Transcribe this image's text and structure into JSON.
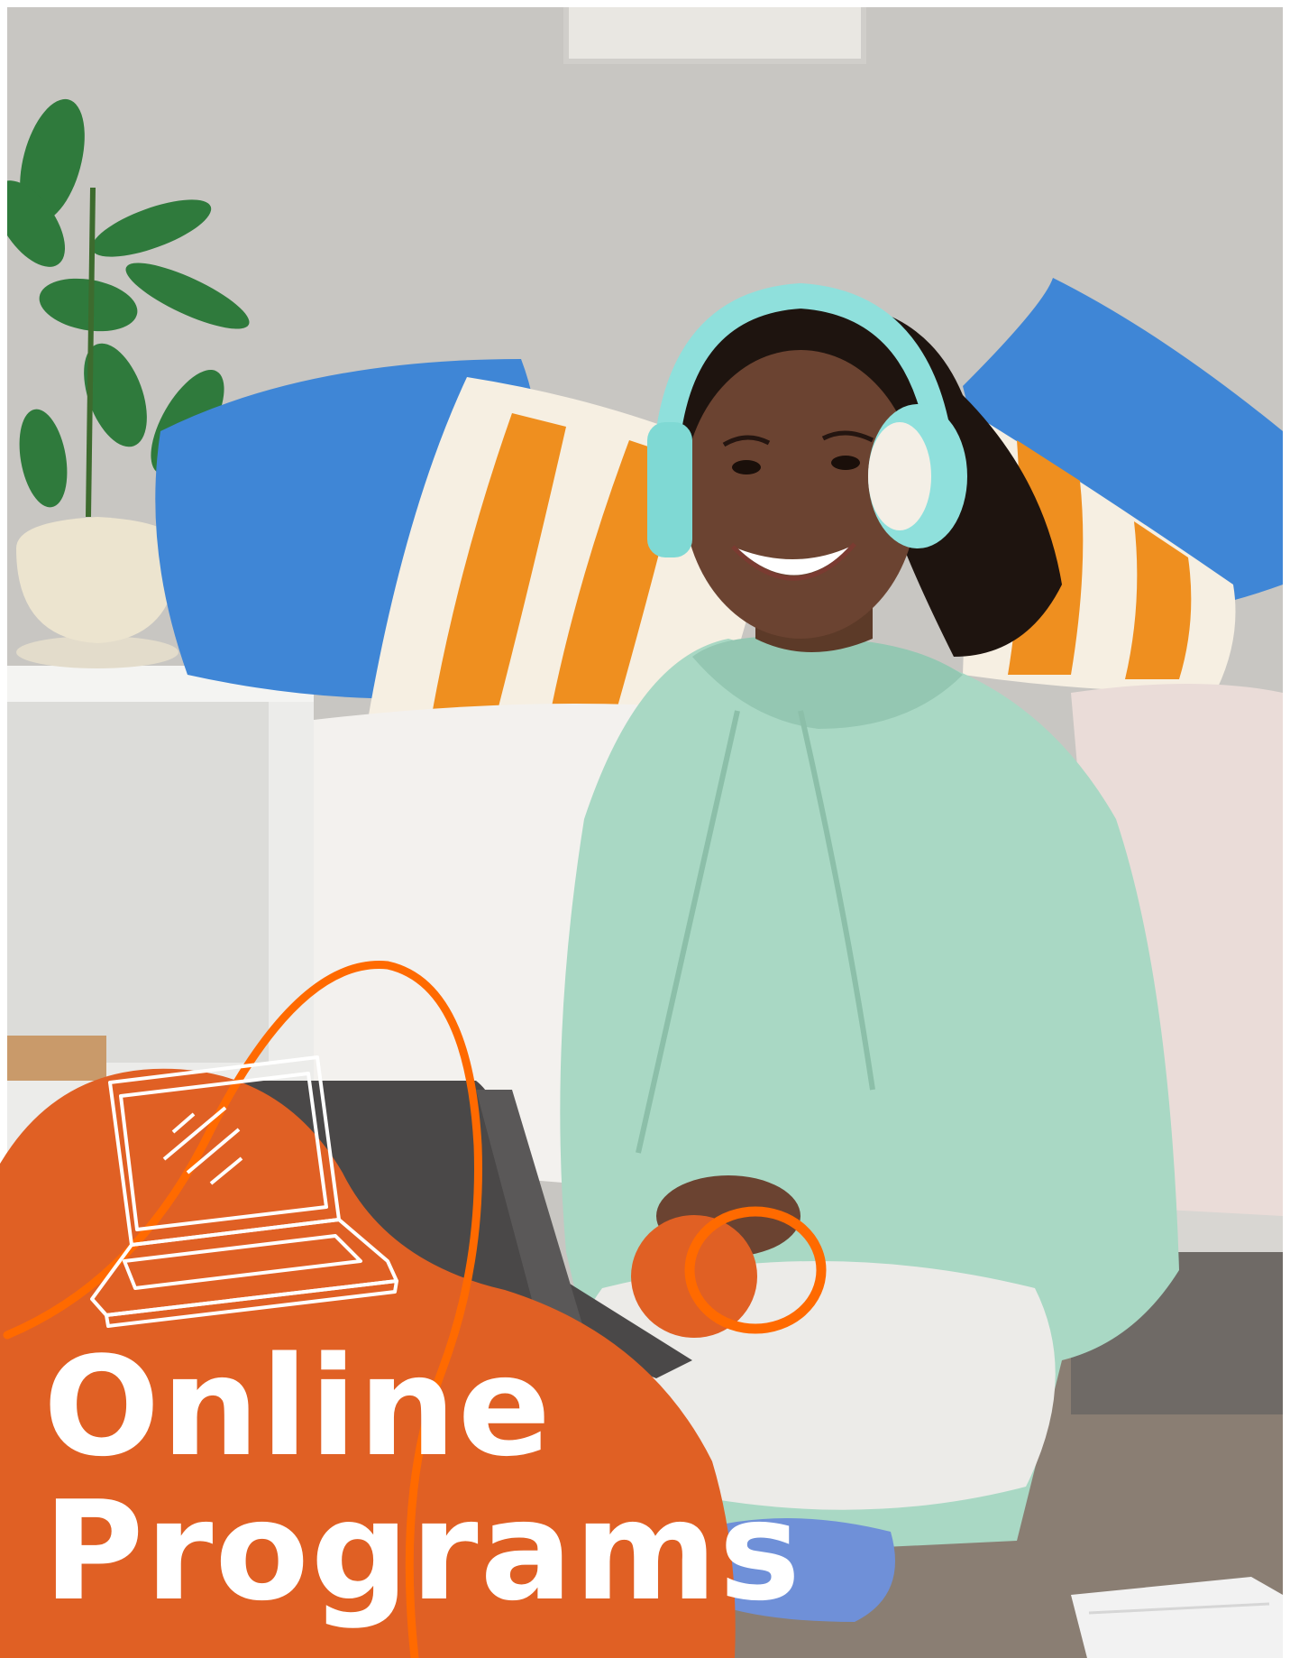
{
  "headline": {
    "line1": "Online",
    "line2": "Programs"
  },
  "colors": {
    "accent_orange": "#e06024",
    "bright_orange": "#ff6a00",
    "headline_text": "#ffffff",
    "wall": "#c9c7c3",
    "hoodie": "#a9d8c4",
    "headphones": "#8fe0dc",
    "pillow_blue": "#3f86d6",
    "pillow_stripe": "#ef8f1f"
  },
  "icons": [
    "laptop-doodle-icon",
    "ring-doodle-icon",
    "swoosh-line-icon"
  ]
}
